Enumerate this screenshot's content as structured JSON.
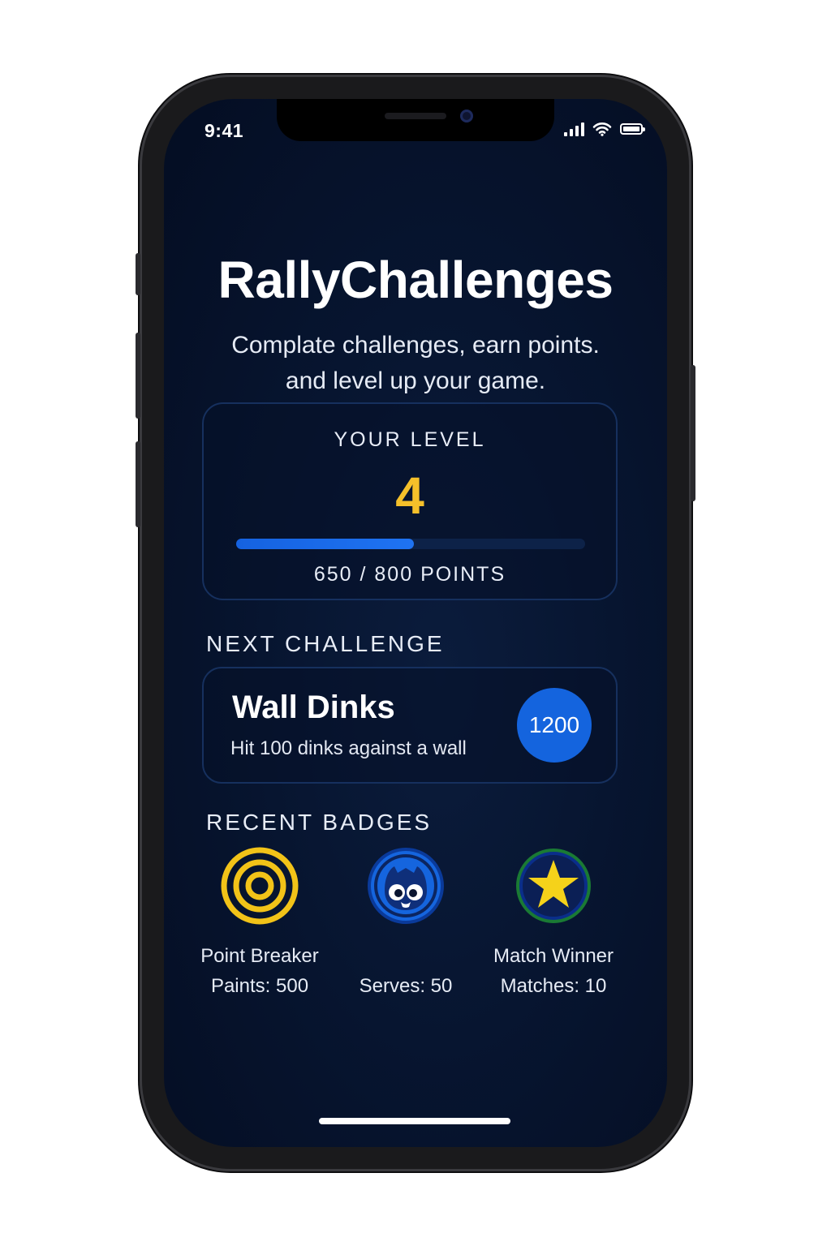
{
  "status_bar": {
    "time": "9:41"
  },
  "header": {
    "title": "RallyChallenges",
    "subtitle": "Complate challenges, earn points.\nand level up your game."
  },
  "level_card": {
    "label": "YOUR LEVEL",
    "level": "4",
    "points_text": "650 / 800 POINTS",
    "progress_fraction": 0.51
  },
  "next_challenge": {
    "heading": "NEXT CHALLENGE",
    "title": "Wall Dinks",
    "description": "Hit 100 dinks against a wall",
    "points": "1200"
  },
  "recent_badges": {
    "heading": "RECENT BADGES",
    "items": [
      {
        "name": "Point Breaker",
        "stat": "Paints: 500",
        "icon": "target-icon",
        "color": "#f2c318"
      },
      {
        "name": "",
        "stat": "Serves: 50",
        "icon": "mascot-icon",
        "color": "#1565de"
      },
      {
        "name": "Match Winner",
        "stat": "Matches: 10",
        "icon": "star-icon",
        "color": "#f5d21a"
      }
    ]
  },
  "colors": {
    "background": "#061329",
    "accent": "#1464de",
    "level_gold": "#f5c02a",
    "card_border": "#16305e"
  }
}
